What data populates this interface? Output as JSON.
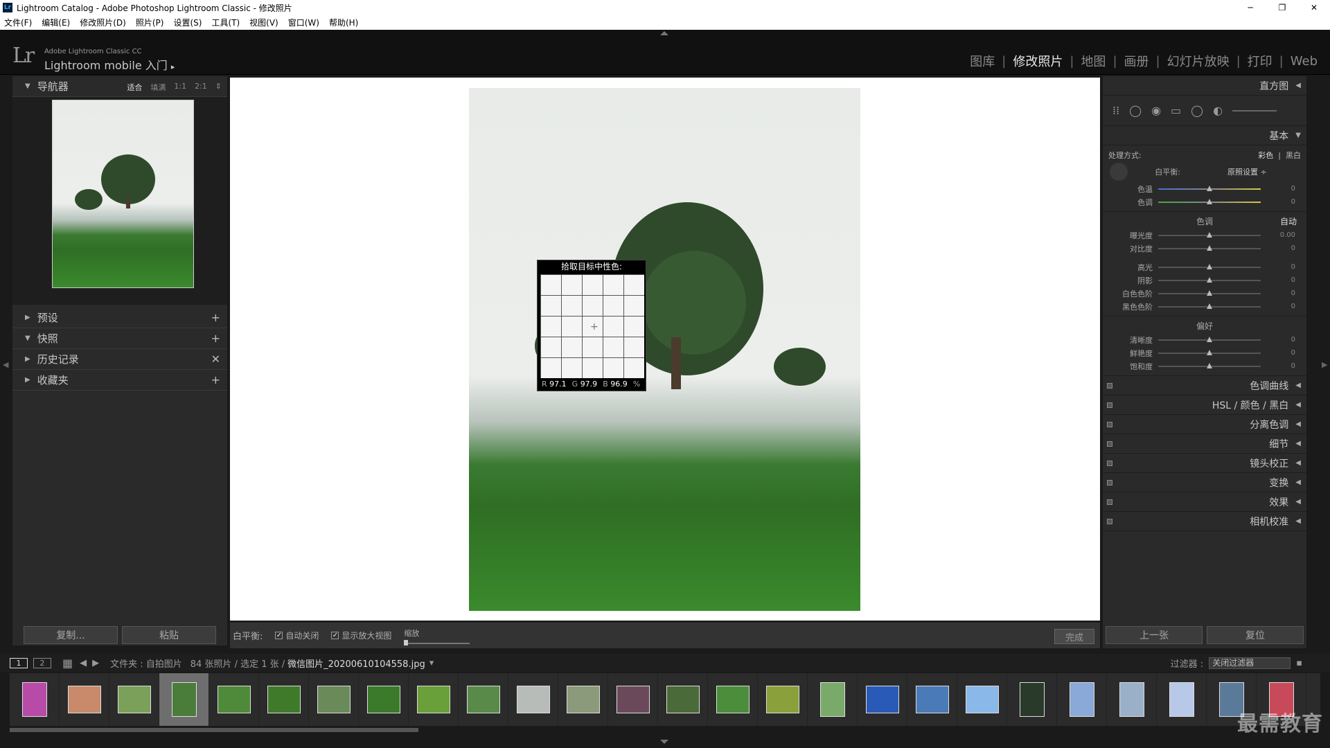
{
  "window": {
    "title": "Lightroom Catalog - Adobe Photoshop Lightroom Classic - 修改照片",
    "logo": "Lr",
    "min": "─",
    "max": "❐",
    "close": "✕"
  },
  "menu": [
    "文件(F)",
    "编辑(E)",
    "修改照片(D)",
    "照片(P)",
    "设置(S)",
    "工具(T)",
    "视图(V)",
    "窗口(W)",
    "帮助(H)"
  ],
  "identity": {
    "logo": "Lr",
    "small": "Adobe Lightroom Classic CC",
    "big": "Lightroom mobile 入门",
    "arrow": "▸"
  },
  "modules": [
    {
      "label": "图库",
      "active": false
    },
    {
      "label": "修改照片",
      "active": true
    },
    {
      "label": "地图",
      "active": false
    },
    {
      "label": "画册",
      "active": false
    },
    {
      "label": "幻灯片放映",
      "active": false
    },
    {
      "label": "打印",
      "active": false
    },
    {
      "label": "Web",
      "active": false
    }
  ],
  "module_sep": "|",
  "left": {
    "navigator": {
      "title": "导航器",
      "opts": [
        "适合",
        "填满",
        "1:1",
        "2:1"
      ],
      "selected": "适合",
      "more": "⇕"
    },
    "panels": [
      {
        "title": "预设",
        "tri": "▶",
        "action": "+"
      },
      {
        "title": "快照",
        "tri": "▼",
        "action": "+"
      },
      {
        "title": "历史记录",
        "tri": "▶",
        "action": "✕"
      },
      {
        "title": "收藏夹",
        "tri": "▶",
        "action": "+"
      }
    ],
    "copy_button": "复制...",
    "paste_button": "粘贴"
  },
  "loupe": {
    "title": "拾取目标中性色:",
    "r_label": "R",
    "r": "97.1",
    "g_label": "G",
    "g": "97.9",
    "b_label": "B",
    "b": "96.9",
    "unit": "%",
    "crosshair": "+"
  },
  "toolbar": {
    "wb_label": "白平衡:",
    "auto_dismiss": "自动关闭",
    "show_loupe": "显示放大视图",
    "zoom_label": "缩放",
    "done": "完成",
    "check": "✓",
    "zoom_value": 0.0
  },
  "right": {
    "histogram": "直方图",
    "tools": [
      "⁞⁞",
      "◯",
      "◉",
      "▭",
      "◯",
      "◐"
    ],
    "basic": "基本",
    "treatment_label": "处理方式:",
    "treatment_color": "彩色",
    "treatment_bw": "黑白",
    "wb_label": "白平衡:",
    "wb_value": "原照设置 ÷",
    "rows_wb": [
      {
        "label": "色温",
        "value": "0",
        "pos": 0.5,
        "color": "#4a6fd8"
      },
      {
        "label": "色调",
        "value": "0",
        "pos": 0.5,
        "color": "#3fa84a"
      }
    ],
    "tone_title": "色调",
    "tone_auto": "自动",
    "rows_tone1": [
      {
        "label": "曝光度",
        "value": "0.00",
        "pos": 0.5
      },
      {
        "label": "对比度",
        "value": "0",
        "pos": 0.5
      }
    ],
    "rows_tone2": [
      {
        "label": "高光",
        "value": "0",
        "pos": 0.5
      },
      {
        "label": "阴影",
        "value": "0",
        "pos": 0.5
      },
      {
        "label": "白色色阶",
        "value": "0",
        "pos": 0.5
      },
      {
        "label": "黑色色阶",
        "value": "0",
        "pos": 0.5
      }
    ],
    "presence_title": "偏好",
    "rows_presence": [
      {
        "label": "清晰度",
        "value": "0",
        "pos": 0.5
      },
      {
        "label": "鲜艳度",
        "value": "0",
        "pos": 0.5
      },
      {
        "label": "饱和度",
        "value": "0",
        "pos": 0.5
      }
    ],
    "panels": [
      "色调曲线",
      "HSL / 颜色 / 黑白",
      "分离色调",
      "细节",
      "镜头校正",
      "变换",
      "效果",
      "相机校准"
    ],
    "prev_button": "上一张",
    "reset_button": "复位"
  },
  "filmbar": {
    "screen1": "1",
    "screen2": "2",
    "grid": "▦",
    "back": "◀",
    "fwd": "▶",
    "source": "文件夹 : 自拍图片",
    "count": "84 张照片 / 选定 1 张 /",
    "filename": "微信图片_20200610104558.jpg",
    "drop": "▾",
    "filter_label": "过滤器 :",
    "filter_value": "关闭过滤器",
    "lock": "▪"
  },
  "watermark": "最需教育"
}
